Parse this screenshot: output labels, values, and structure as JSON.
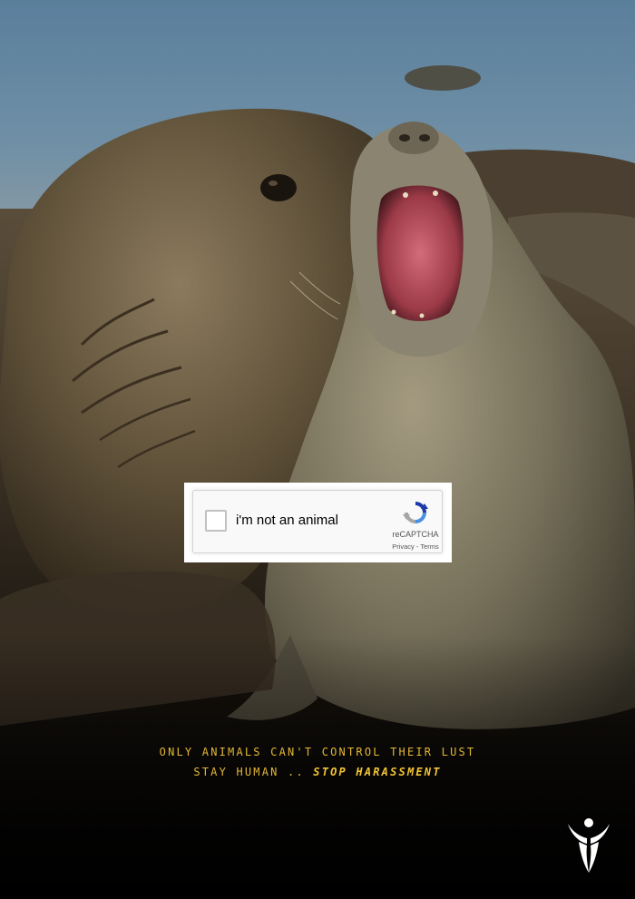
{
  "captcha": {
    "checkbox_label": "i'm not an animal",
    "brand": "reCAPTCHA",
    "privacy_link": "Privacy",
    "separator": " - ",
    "terms_link": "Terms",
    "icon": "recaptcha-logo-icon"
  },
  "tagline": {
    "line1": "ONLY ANIMALS CAN'T CONTROL THEIR LUST",
    "line2_prefix": "STAY HUMAN .. ",
    "line2_emphasis": "STOP HARASSMENT"
  },
  "logo": {
    "icon": "human-figure-logo-icon"
  },
  "colors": {
    "tagline": "#e2b735",
    "background_bottom": "#0a0806",
    "water": "#4a6f8c",
    "seal_body": "#6b5c44",
    "recaptcha_blue": "#1c3aa9",
    "recaptcha_light_blue": "#4a90e2"
  }
}
